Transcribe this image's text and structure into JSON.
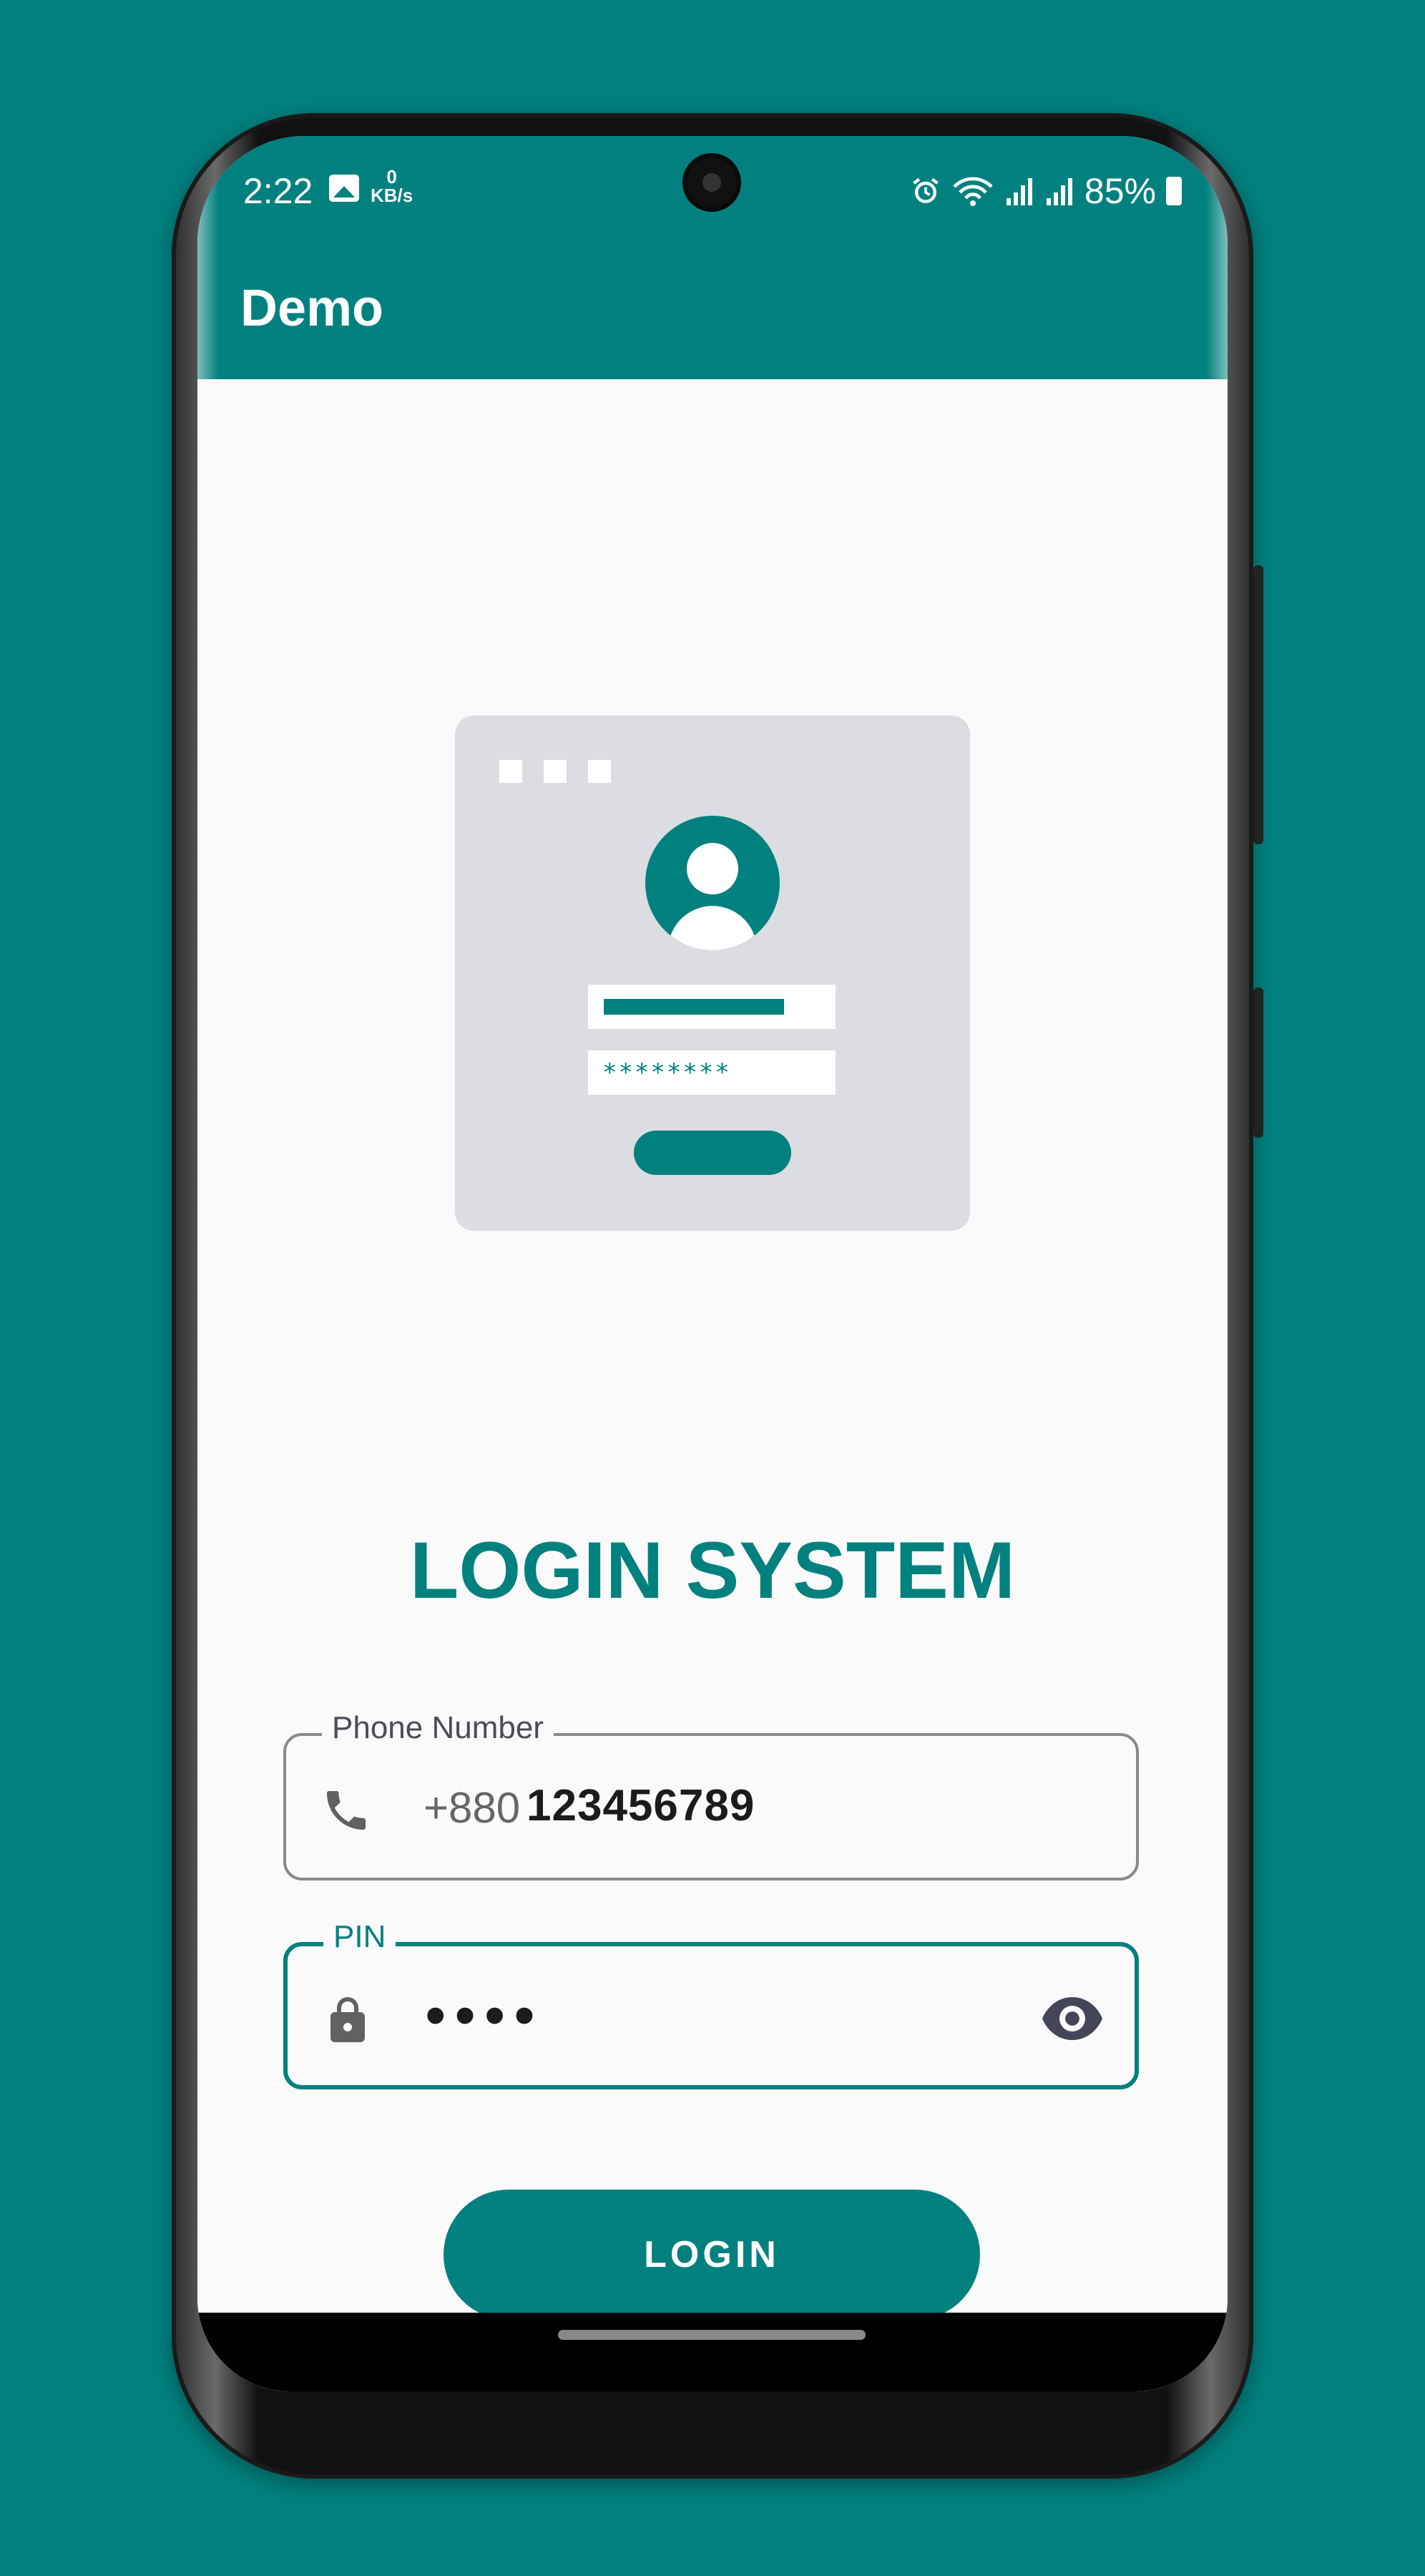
{
  "status_bar": {
    "time": "2:22",
    "net_speed_value": "0",
    "net_speed_unit": "KB/s",
    "battery": "85%"
  },
  "app_bar": {
    "title": "Demo"
  },
  "illustration": {
    "password_mask": "********"
  },
  "heading": "LOGIN SYSTEM",
  "phone_field": {
    "label": "Phone Number",
    "prefix": "+880",
    "value": "123456789",
    "icon": "phone-icon"
  },
  "pin_field": {
    "label": "PIN",
    "masked_value": "••••",
    "icon": "lock-icon",
    "toggle_icon": "eye-icon"
  },
  "login_button": {
    "label": "LOGIN"
  },
  "colors": {
    "primary": "#00817f",
    "background": "#fafafa",
    "text_dark": "#1c1c1c"
  }
}
